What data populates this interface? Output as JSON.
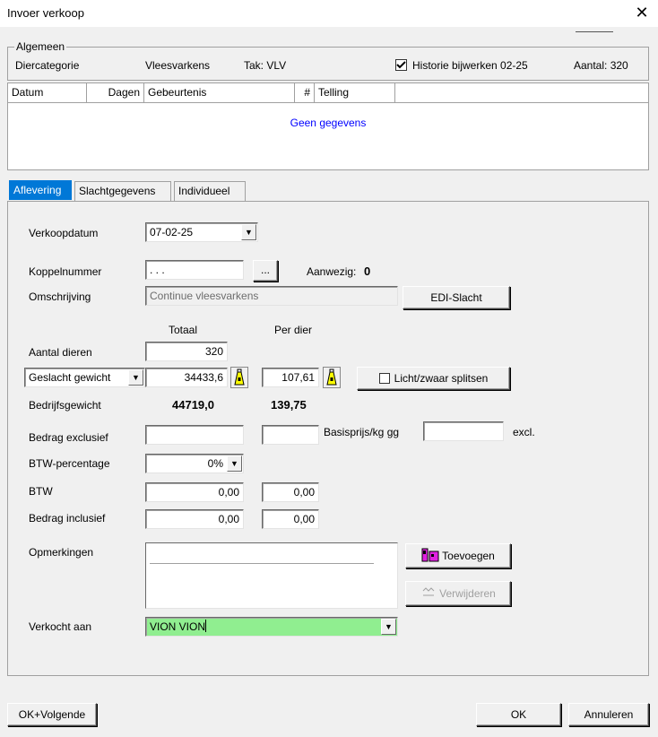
{
  "window": {
    "title": "Invoer verkoop",
    "close_glyph": "✕"
  },
  "algemeen": {
    "legend": "Algemeen",
    "diercategorie_label": "Diercategorie",
    "diercategorie_value": "Vleesvarkens",
    "tak": "Tak: VLV",
    "historie_label": "Historie bijwerken 02-25",
    "historie_checked": true,
    "aantal": "Aantal: 320"
  },
  "grid": {
    "columns": [
      "Datum",
      "Dagen",
      "Gebeurtenis",
      "#",
      "Telling"
    ],
    "empty_text": "Geen gegevens"
  },
  "tabs": [
    {
      "label": "Aflevering",
      "active": true
    },
    {
      "label": "Slachtgegevens",
      "active": false
    },
    {
      "label": "Individueel",
      "active": false
    }
  ],
  "form": {
    "verkoopdatum_label": "Verkoopdatum",
    "verkoopdatum_value": "07-02-25",
    "koppelnummer_label": "Koppelnummer",
    "koppelnummer_value": ". . .",
    "ellipsis_label": "...",
    "aanwezig_label": "Aanwezig:",
    "aanwezig_value": "0",
    "omschrijving_label": "Omschrijving",
    "omschrijving_value": "Continue vleesvarkens",
    "edi_button": "EDI-Slacht",
    "totaal_header": "Totaal",
    "per_dier_header": "Per dier",
    "aantal_dieren_label": "Aantal dieren",
    "aantal_dieren_value": "320",
    "gewicht_type": "Geslacht gewicht",
    "gewicht_totaal": "34433,6",
    "gewicht_per_dier": "107,61",
    "licht_zwaar_label": "Licht/zwaar splitsen",
    "bedrijfsgewicht_label": "Bedrijfsgewicht",
    "bedrijfsgewicht_totaal": "44719,0",
    "bedrijfsgewicht_per_dier": "139,75",
    "bedrag_excl_label": "Bedrag exclusief",
    "bedrag_excl_value": "",
    "bedrag_excl_per_dier": "",
    "basisprijs_label": "Basisprijs/kg gg",
    "basisprijs_value": "",
    "excl_label": "excl.",
    "btw_pct_label": "BTW-percentage",
    "btw_pct_value": "0%",
    "btw_label": "BTW",
    "btw_totaal": "0,00",
    "btw_per_dier": "0,00",
    "bedrag_incl_label": "Bedrag inclusief",
    "bedrag_incl_totaal": "0,00",
    "bedrag_incl_per_dier": "0,00",
    "opmerkingen_label": "Opmerkingen",
    "toevoegen_button": "Toevoegen",
    "verwijderen_button": "Verwijderen",
    "verkocht_aan_label": "Verkocht aan",
    "verkocht_aan_value": "VION VION"
  },
  "footer": {
    "ok_volgende": "OK+Volgende",
    "ok": "OK",
    "annuleren": "Annuleren"
  },
  "colors": {
    "active_tab": "#0078d7",
    "grid_empty_text": "#0000ff",
    "customer_field": "#90ee90",
    "icon_magenta": "#e020e0",
    "scale_yellow": "#ffff00"
  }
}
